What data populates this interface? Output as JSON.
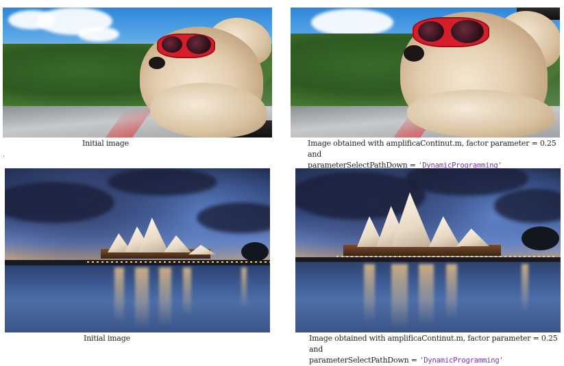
{
  "figures": [
    {
      "caption": "Initial image",
      "alt": "dog"
    },
    {
      "caption_line1": "Image obtained with amplificaContinut.m, factor parameter = 0.25 and",
      "caption_line2_prefix": "parameterSelectPathDown = ",
      "caption_code": "'DynamicProgramming'",
      "alt": "dog-amplified"
    },
    {
      "caption": "Initial image",
      "alt": "opera"
    },
    {
      "caption_line1": "Image obtained with amplificaContinut.m, factor parameter = 0.25 and",
      "caption_line2_prefix": "parameterSelectPathDown = ",
      "caption_code": "'DynamicProgramming'",
      "alt": "opera-amplified"
    }
  ],
  "stray_dot": ".",
  "colors": {
    "code": "#7a2fb0",
    "text": "#222222"
  }
}
